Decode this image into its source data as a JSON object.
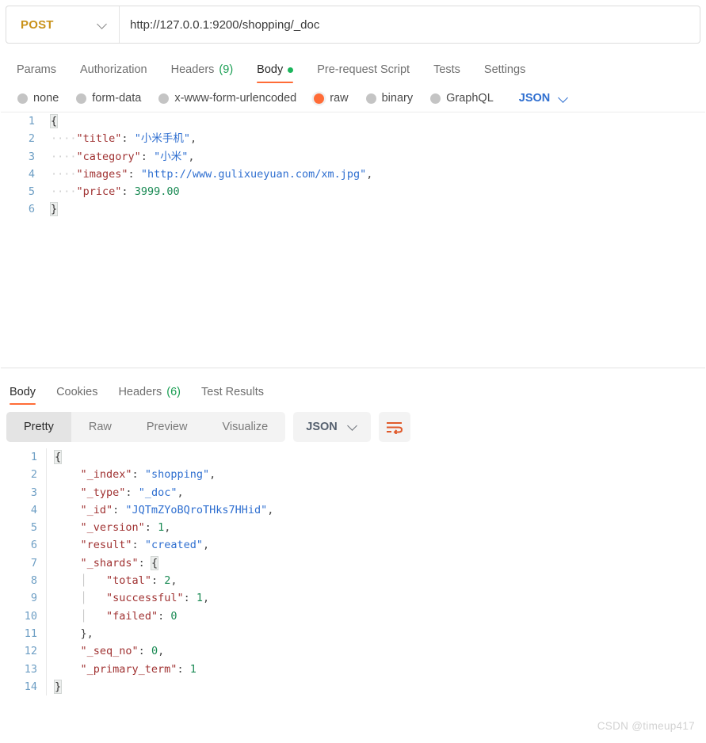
{
  "request": {
    "method": "POST",
    "url": "http://127.0.0.1:9200/shopping/_doc",
    "tabs": [
      {
        "label": "Params",
        "active": false
      },
      {
        "label": "Authorization",
        "active": false
      },
      {
        "label": "Headers",
        "count": "(9)",
        "active": false
      },
      {
        "label": "Body",
        "active": true,
        "has_dot": true
      },
      {
        "label": "Pre-request Script",
        "active": false
      },
      {
        "label": "Tests",
        "active": false
      },
      {
        "label": "Settings",
        "active": false
      }
    ],
    "body_types": [
      {
        "label": "none",
        "selected": false
      },
      {
        "label": "form-data",
        "selected": false
      },
      {
        "label": "x-www-form-urlencoded",
        "selected": false
      },
      {
        "label": "raw",
        "selected": true
      },
      {
        "label": "binary",
        "selected": false
      },
      {
        "label": "GraphQL",
        "selected": false
      }
    ],
    "format_label": "JSON",
    "code": {
      "lines": [
        "1",
        "2",
        "3",
        "4",
        "5",
        "6"
      ],
      "l1": "{",
      "l2_ws": "····",
      "l2_key": "\"title\"",
      "l2_sep": ": ",
      "l2_val": "\"小米手机\"",
      "l2_end": ",",
      "l3_ws": "····",
      "l3_key": "\"category\"",
      "l3_sep": ": ",
      "l3_val": "\"小米\"",
      "l3_end": ",",
      "l4_ws": "····",
      "l4_key": "\"images\"",
      "l4_sep": ": ",
      "l4_val": "\"http://www.gulixueyuan.com/xm.jpg\"",
      "l4_end": ",",
      "l5_ws": "····",
      "l5_key": "\"price\"",
      "l5_sep": ": ",
      "l5_val": "3999.00",
      "l6": "}"
    }
  },
  "response": {
    "tabs": [
      {
        "label": "Body",
        "active": true
      },
      {
        "label": "Cookies",
        "active": false
      },
      {
        "label": "Headers",
        "count": "(6)",
        "active": false
      },
      {
        "label": "Test Results",
        "active": false
      }
    ],
    "view_modes": [
      {
        "label": "Pretty",
        "active": true
      },
      {
        "label": "Raw",
        "active": false
      },
      {
        "label": "Preview",
        "active": false
      },
      {
        "label": "Visualize",
        "active": false
      }
    ],
    "format_label": "JSON",
    "wrap_icon": "word-wrap-icon",
    "code": {
      "lines": [
        "1",
        "2",
        "3",
        "4",
        "5",
        "6",
        "7",
        "8",
        "9",
        "10",
        "11",
        "12",
        "13",
        "14"
      ],
      "l1": "{",
      "l2_key": "\"_index\"",
      "l2_val": "\"shopping\"",
      "l3_key": "\"_type\"",
      "l3_val": "\"_doc\"",
      "l4_key": "\"_id\"",
      "l4_val": "\"JQTmZYoBQroTHks7HHid\"",
      "l5_key": "\"_version\"",
      "l5_val": "1",
      "l6_key": "\"result\"",
      "l6_val": "\"created\"",
      "l7_key": "\"_shards\"",
      "l7_val": "{",
      "l8_key": "\"total\"",
      "l8_val": "2",
      "l9_key": "\"successful\"",
      "l9_val": "1",
      "l10_key": "\"failed\"",
      "l10_val": "0",
      "l11": "},",
      "l12_key": "\"_seq_no\"",
      "l12_val": "0",
      "l13_key": "\"_primary_term\"",
      "l13_val": "1",
      "l14": "}",
      "comma": ",",
      "colon": ": "
    }
  },
  "watermark": "CSDN @timeup417",
  "colors": {
    "accent_orange": "#ff6c37",
    "method_amber": "#c9921a",
    "dot_green": "#1cb55c",
    "json_blue": "#2f6fd0",
    "key_red": "#a03232",
    "number_green": "#1a8a54"
  }
}
